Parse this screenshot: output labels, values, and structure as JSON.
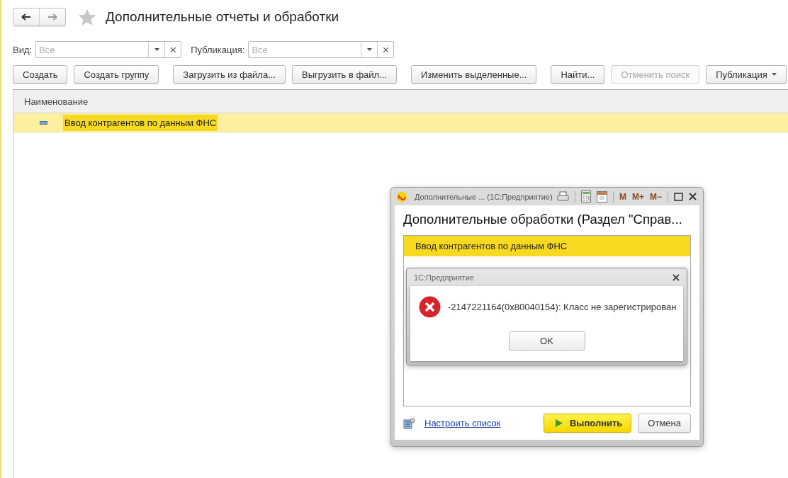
{
  "window": {
    "title": "Дополнительные отчеты и обработки",
    "favorite": false
  },
  "filters": [
    {
      "label": "Вид:",
      "placeholder": "Все"
    },
    {
      "label": "Публикация:",
      "placeholder": "Все"
    }
  ],
  "toolbar": [
    {
      "label": "Создать",
      "kind": "plain",
      "disabled": false
    },
    {
      "label": "Создать группу",
      "kind": "plain",
      "disabled": false
    },
    {
      "label": "Загрузить из файла...",
      "kind": "plain",
      "disabled": false
    },
    {
      "label": "Выгрузить в файл...",
      "kind": "plain",
      "disabled": false
    },
    {
      "label": "Изменить выделенные...",
      "kind": "plain",
      "disabled": false
    },
    {
      "label": "Найти...",
      "kind": "plain",
      "disabled": false
    },
    {
      "label": "Отменить поиск",
      "kind": "plain",
      "disabled": true
    },
    {
      "label": "Публикация",
      "kind": "dropdown",
      "disabled": false
    }
  ],
  "table": {
    "columns": [
      "Наименование"
    ],
    "rows": [
      {
        "name": "Ввод контрагентов по данным ФНС",
        "selected": true
      }
    ]
  },
  "processing_window": {
    "title": "Дополнительные ...  (1С:Предприятие)",
    "heading": "Дополнительные обработки (Раздел \"Справ...",
    "tools": [
      "M",
      "M+",
      "M−"
    ],
    "items": [
      {
        "name": "Ввод контрагентов по данным ФНС",
        "selected": true
      }
    ],
    "link": "Настроить список",
    "buttons": [
      {
        "label": "Выполнить",
        "kind": "primary"
      },
      {
        "label": "Отмена",
        "kind": "plain"
      }
    ]
  },
  "message_box": {
    "title": "1С:Предприятие",
    "text": "-2147221164(0x80040154): Класс не зарегистрирован",
    "buttons": [
      "OK"
    ]
  }
}
